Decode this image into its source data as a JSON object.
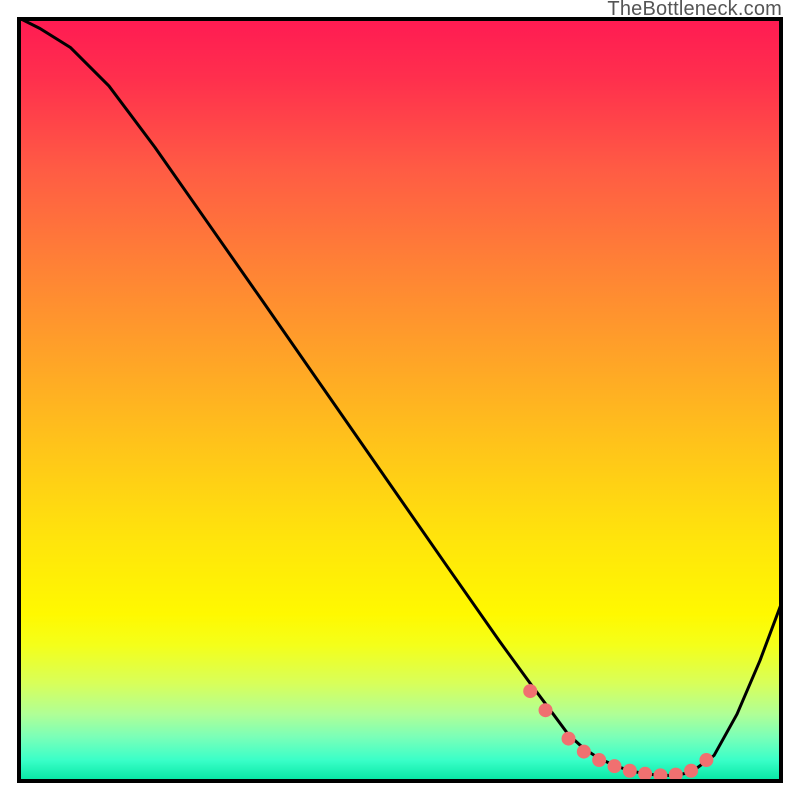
{
  "attribution": "TheBottleneck.com",
  "colors": {
    "curve": "#000000",
    "marker_fill": "#f07070",
    "marker_stroke": "#e05858",
    "frame": "#000000"
  },
  "chart_data": {
    "type": "line",
    "title": "",
    "xlabel": "",
    "ylabel": "",
    "xlim": [
      0,
      100
    ],
    "ylim": [
      0,
      100
    ],
    "x": [
      0,
      3,
      7,
      12,
      18,
      25,
      32,
      40,
      48,
      56,
      63,
      67,
      70,
      72,
      74,
      76,
      78,
      80,
      82,
      84,
      86,
      88,
      91,
      94,
      97,
      100
    ],
    "values": [
      100,
      98.5,
      96,
      91,
      83,
      73,
      63,
      51.5,
      40,
      28.5,
      18.5,
      13,
      9,
      6.3,
      4.5,
      3.2,
      2.3,
      1.6,
      1.2,
      1.0,
      1.0,
      1.4,
      3.6,
      9,
      16,
      24
    ],
    "markers": {
      "x": [
        67,
        69,
        72,
        74,
        76,
        78,
        80,
        82,
        84,
        86,
        88,
        90
      ],
      "y": [
        12.0,
        9.5,
        5.8,
        4.1,
        3.0,
        2.2,
        1.6,
        1.2,
        1.0,
        1.1,
        1.6,
        3.0
      ]
    }
  }
}
